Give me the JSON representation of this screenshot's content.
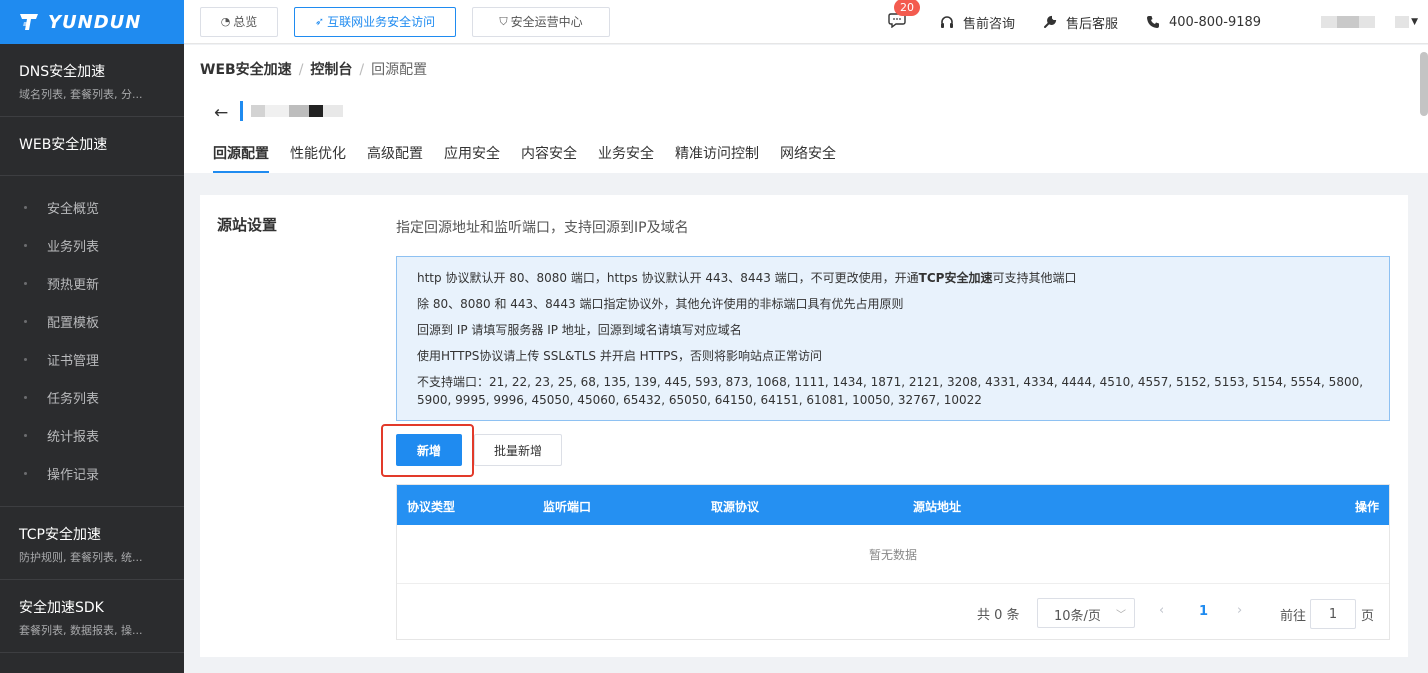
{
  "brand": {
    "name": "YUNDUN"
  },
  "sidebar": {
    "dns": {
      "title": "DNS安全加速",
      "sub": "域名列表, 套餐列表, 分..."
    },
    "web": {
      "title": "WEB安全加速"
    },
    "web_items": [
      "安全概览",
      "业务列表",
      "预热更新",
      "配置模板",
      "证书管理",
      "任务列表",
      "统计报表",
      "操作记录"
    ],
    "tcp": {
      "title": "TCP安全加速",
      "sub": "防护规则, 套餐列表, 统..."
    },
    "sdk": {
      "title": "安全加速SDK",
      "sub": "套餐列表, 数据报表, 操..."
    }
  },
  "topbar": {
    "overview": "总览",
    "internet_access": "互联网业务安全访问",
    "soc": "安全运营中心",
    "message_count": "20",
    "presale": "售前咨询",
    "aftersale": "售后客服",
    "phone": "400-800-9189"
  },
  "breadcrumb": {
    "a": "WEB安全加速",
    "b": "控制台",
    "c": "回源配置",
    "sep": "/"
  },
  "tabs": [
    "回源配置",
    "性能优化",
    "高级配置",
    "应用安全",
    "内容安全",
    "业务安全",
    "精准访问控制",
    "网络安全"
  ],
  "section": {
    "title": "源站设置",
    "desc": "指定回源地址和监听端口，支持回源到IP及域名"
  },
  "notice": {
    "line1_pre": "http 协议默认开 80、8080 端口，https 协议默认开 443、8443 端口，不可更改使用，开通",
    "line1_bold": "TCP安全加速",
    "line1_post": "可支持其他端口",
    "line2": "除 80、8080 和 443、8443 端口指定协议外，其他允许使用的非标端口具有优先占用原则",
    "line3": "回源到 IP 请填写服务器 IP 地址，回源到域名请填写对应域名",
    "line4": "使用HTTPS协议请上传 SSL&TLS 并开启 HTTPS，否则将影响站点正常访问",
    "line5": "不支持端口：21, 22, 23, 25, 68, 135, 139, 445, 593, 873, 1068, 1111, 1434, 1871, 2121, 3208, 4331, 4334, 4444, 4510, 4557, 5152, 5153, 5154, 5554, 5800, 5900, 9995, 9996, 45050, 45060, 65432, 65050, 64150, 64151, 61081, 10050, 32767, 10022"
  },
  "buttons": {
    "add": "新增",
    "batch_add": "批量新增"
  },
  "table": {
    "columns": [
      "协议类型",
      "监听端口",
      "取源协议",
      "源站地址",
      "操作"
    ],
    "empty": "暂无数据"
  },
  "pager": {
    "total": "共 0 条",
    "page_size": "10条/页",
    "current": "1",
    "goto": "前往",
    "goto_value": "1",
    "page_unit": "页"
  },
  "colors": {
    "accent": "#1f8bf0",
    "sidebar_bg": "#2b2c2e",
    "highlight": "#e23a2a"
  }
}
